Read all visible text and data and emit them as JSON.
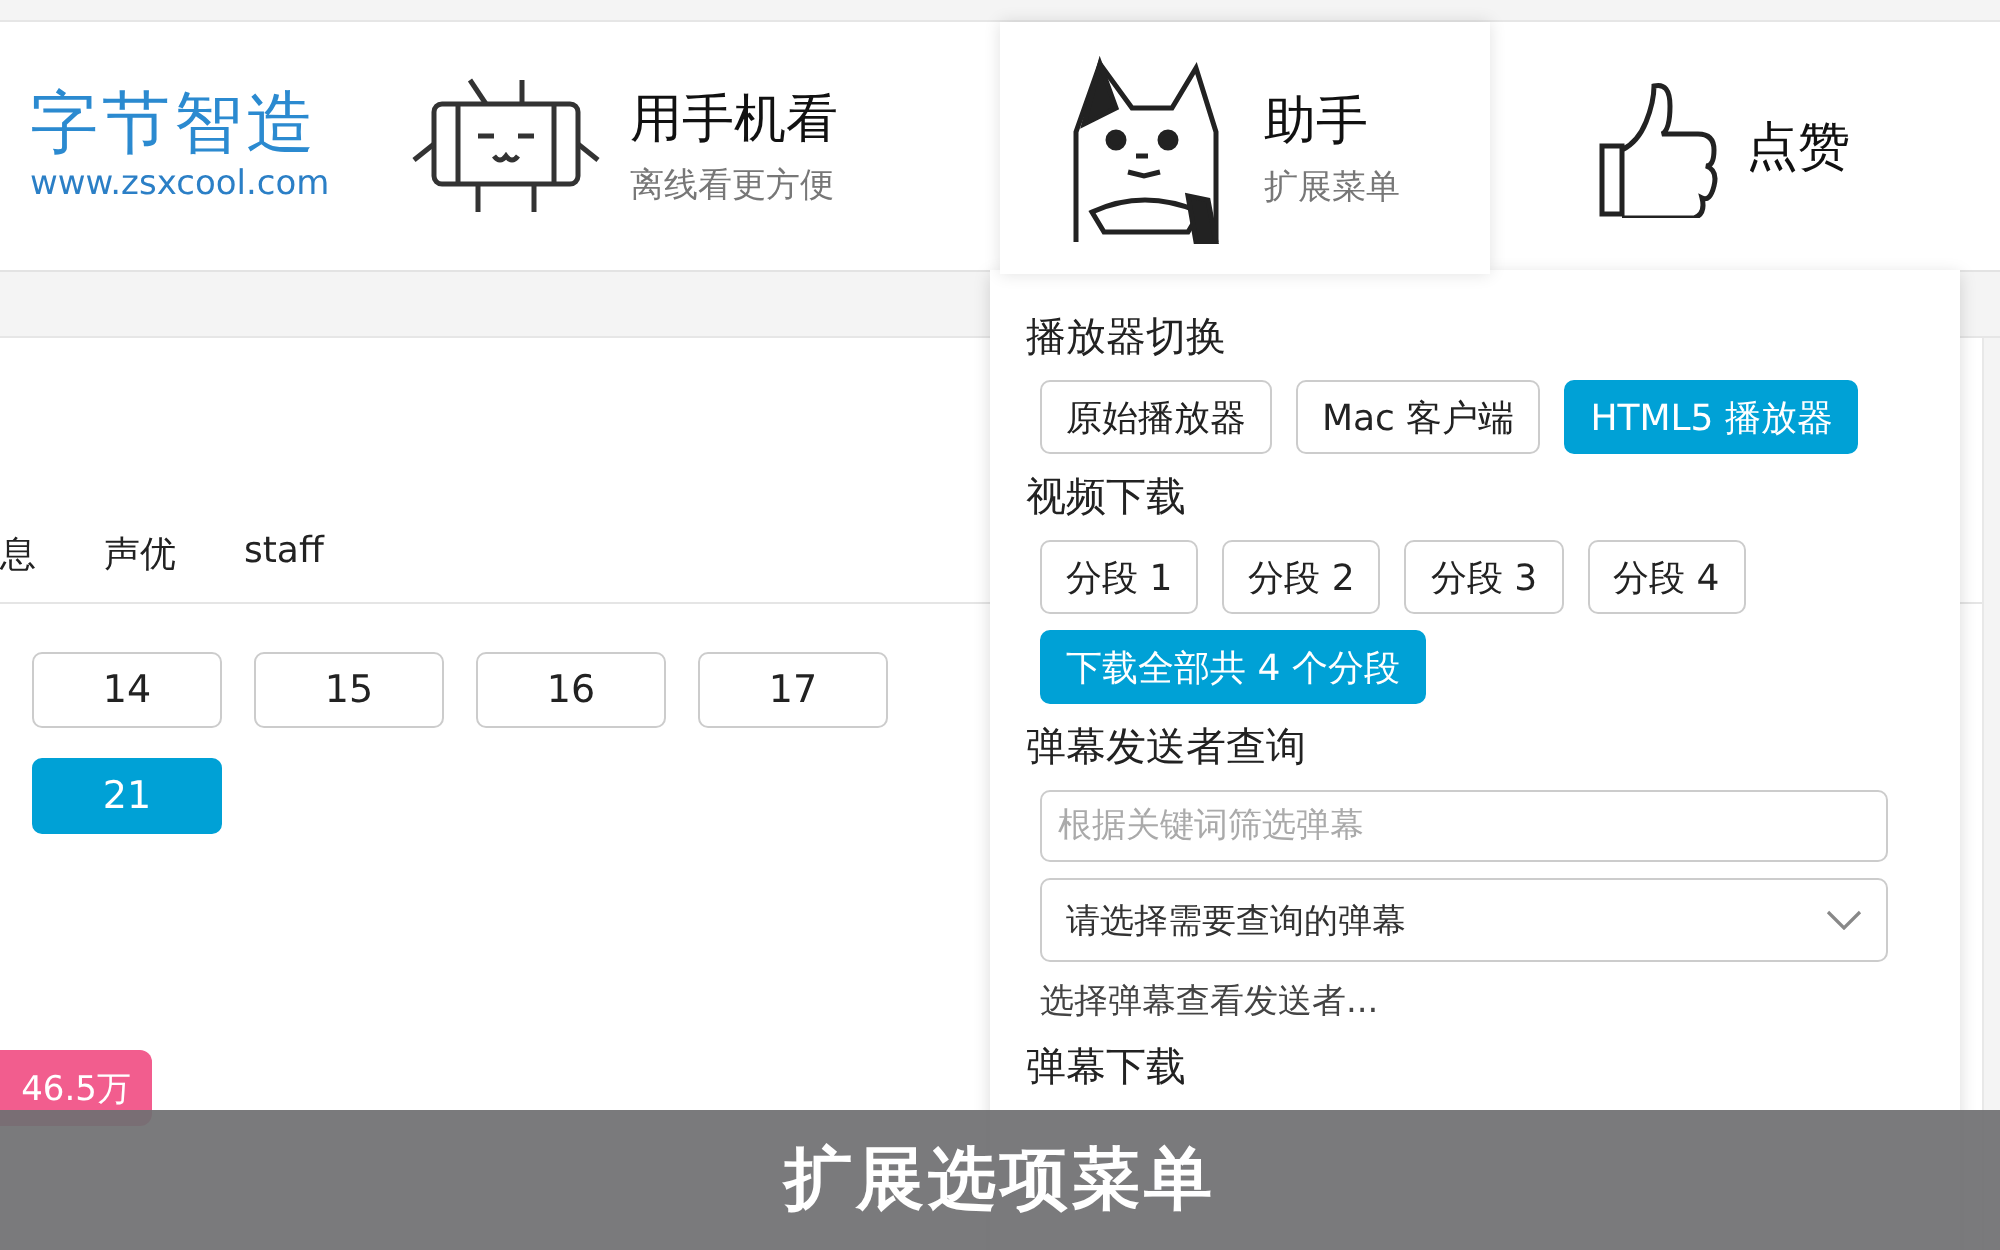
{
  "header": {
    "logo": {
      "name": "字节智造",
      "url": "www.zsxcool.com"
    },
    "items": [
      {
        "kind": "mobile",
        "title": "用手机看",
        "subtitle": "离线看更方便",
        "selected": false
      },
      {
        "kind": "helper",
        "title": "助手",
        "subtitle": "扩展菜单",
        "selected": true
      },
      {
        "kind": "like",
        "title": "点赞",
        "selected": false
      }
    ]
  },
  "tabs": [
    {
      "label": "息"
    },
    {
      "label": "声优"
    },
    {
      "label": "staff"
    }
  ],
  "episodes": [
    {
      "label": "14",
      "selected": false
    },
    {
      "label": "15",
      "selected": false
    },
    {
      "label": "16",
      "selected": false
    },
    {
      "label": "17",
      "selected": false
    },
    {
      "label": "21",
      "selected": true
    }
  ],
  "badge": "46.5万",
  "menu": {
    "sections": [
      {
        "kind": "buttons",
        "title": "播放器切换",
        "buttons": [
          {
            "label": "原始播放器",
            "selected": false
          },
          {
            "label": "Mac 客户端",
            "selected": false
          },
          {
            "label": "HTML5 播放器",
            "selected": true
          }
        ]
      },
      {
        "kind": "buttons",
        "title": "视频下载",
        "buttons": [
          {
            "label": "分段 1",
            "selected": false
          },
          {
            "label": "分段 2",
            "selected": false
          },
          {
            "label": "分段 3",
            "selected": false
          },
          {
            "label": "分段 4",
            "selected": false
          }
        ],
        "action": "下载全部共 4 个分段"
      },
      {
        "kind": "query",
        "title": "弹幕发送者查询",
        "placeholder": "根据关键词筛选弹幕",
        "select_value": "请选择需要查询的弹幕",
        "hint": "选择弹幕查看发送者..."
      },
      {
        "kind": "heading",
        "title": "弹幕下载"
      }
    ]
  },
  "caption": "扩展选项菜单"
}
